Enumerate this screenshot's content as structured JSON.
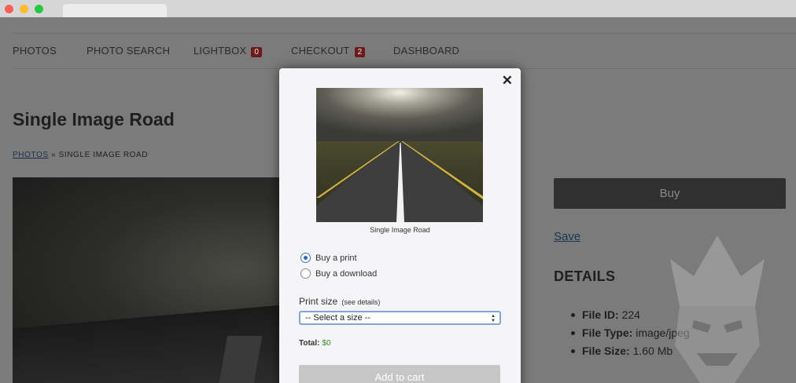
{
  "nav": {
    "items": [
      {
        "label": "PHOTOS"
      },
      {
        "label": "PHOTO SEARCH"
      },
      {
        "label": "LIGHTBOX",
        "badge": "0"
      },
      {
        "label": "CHECKOUT",
        "badge": "2"
      },
      {
        "label": "DASHBOARD"
      }
    ]
  },
  "page": {
    "title": "Single Image Road",
    "breadcrumb_link": "PHOTOS",
    "breadcrumb_sep": " » ",
    "breadcrumb_current": "SINGLE IMAGE ROAD",
    "buy_label": "Buy",
    "save_label": "Save",
    "details_heading": "DETAILS",
    "details": [
      {
        "key": "File ID:",
        "value": "224"
      },
      {
        "key": "File Type:",
        "value": "image/jpeg"
      },
      {
        "key": "File Size:",
        "value": "1.60 Mb"
      }
    ]
  },
  "modal": {
    "close": "✕",
    "caption": "Single Image Road",
    "option_print": "Buy a print",
    "option_download": "Buy a download",
    "print_size_label": "Print size",
    "see_details": "(see details)",
    "select_value": "-- Select a size --",
    "total_label": "Total:",
    "total_value": "$0",
    "add_to_cart": "Add to cart"
  },
  "colors": {
    "badge_bg": "#6d1a1a",
    "radio_accent": "#2a62b5",
    "total_green": "#3a8a2a"
  }
}
